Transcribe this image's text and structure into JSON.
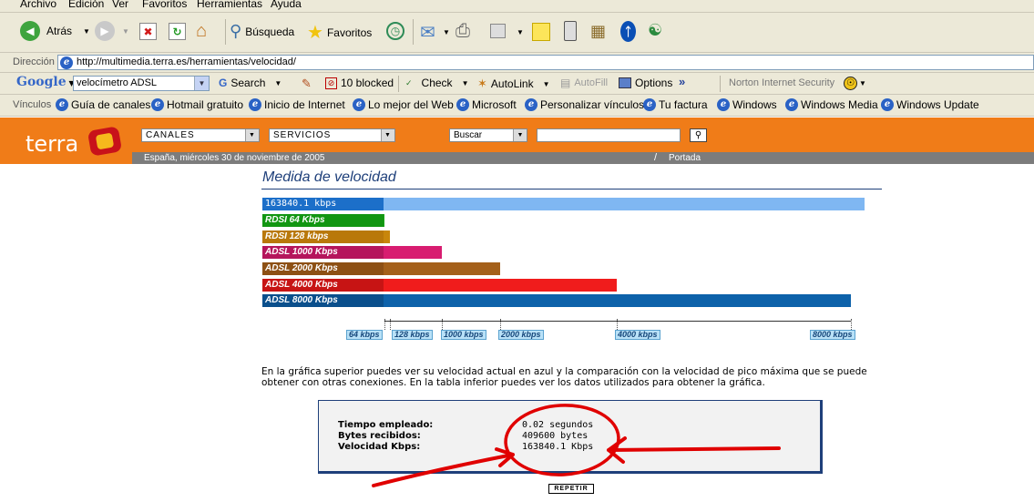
{
  "menu": [
    "Archivo",
    "Edición",
    "Ver",
    "Favoritos",
    "Herramientas",
    "Ayuda"
  ],
  "toolbar": {
    "back": "Atrás",
    "search": "Búsqueda",
    "favorites": "Favoritos"
  },
  "address": {
    "label": "Dirección",
    "url": "http://multimedia.terra.es/herramientas/velocidad/"
  },
  "google_bar": {
    "logo": "Google",
    "query": "velocímetro ADSL",
    "search": "Search",
    "blocked": "10 blocked",
    "check": "Check",
    "autolink": "AutoLink",
    "autofill": "AutoFill",
    "options": "Options",
    "more": "»",
    "norton": "Norton Internet Security"
  },
  "links": {
    "label": "Vínculos",
    "items": [
      "Guía de canales",
      "Hotmail gratuito",
      "Inicio de Internet",
      "Lo mejor del Web",
      "Microsoft",
      "Personalizar vínculos",
      "Tu factura",
      "Windows",
      "Windows Media",
      "Windows Update"
    ]
  },
  "terra": {
    "logo": "terra",
    "canales": "CANALES",
    "servicios": "SERVICIOS",
    "buscar": "Buscar",
    "search_value": "",
    "date": "España, miércoles 30 de noviembre de 2005",
    "portada": "Portada"
  },
  "page": {
    "title": "Medida de velocidad",
    "description": "En la gráfica superior puedes ver su velocidad actual en azul y la comparación con la velocidad de pico máxima que se puede obtener con otras conexiones. En la tabla inferior puedes ver los datos utilizados para obtener la gráfica.",
    "repeat_button": "REPETIR"
  },
  "chart_data": {
    "type": "bar",
    "orientation": "horizontal",
    "scale_max_kbps": 8000,
    "rows": [
      {
        "label": "163840.1 kbps",
        "value": 163840.1,
        "color": "#7fb7f2",
        "label_color": "#1c6fc9"
      },
      {
        "label": "RDSI  64 Kbps",
        "value": 64,
        "color": "#1aa51a",
        "label_color": "#129612"
      },
      {
        "label": "RDSI 128 kbps",
        "value": 128,
        "color": "#c8860c",
        "label_color": "#b9780a"
      },
      {
        "label": "ADSL 1000 Kbps",
        "value": 1000,
        "color": "#d81c70",
        "label_color": "#b5155c"
      },
      {
        "label": "ADSL 2000 Kbps",
        "value": 2000,
        "color": "#a4601a",
        "label_color": "#8d5014"
      },
      {
        "label": "ADSL 4000 Kbps",
        "value": 4000,
        "color": "#f01c1c",
        "label_color": "#c71414"
      },
      {
        "label": "ADSL 8000 Kbps",
        "value": 8000,
        "color": "#0d62aa",
        "label_color": "#0a4f8c"
      }
    ],
    "ticks": [
      {
        "label": "64 kbps",
        "value": 64
      },
      {
        "label": "128 kbps",
        "value": 128
      },
      {
        "label": "1000 kbps",
        "value": 1000
      },
      {
        "label": "2000 kbps",
        "value": 2000
      },
      {
        "label": "4000 kbps",
        "value": 4000
      },
      {
        "label": "8000 kbps",
        "value": 8000
      }
    ]
  },
  "stats": [
    {
      "key": "Tiempo empleado:",
      "value": "0.02 segundos"
    },
    {
      "key": "Bytes recibidos:",
      "value": "409600 bytes"
    },
    {
      "key": "Velocidad Kbps:",
      "value": "163840.1 Kbps"
    }
  ],
  "colors": {
    "terra_orange": "#f07c18",
    "terra_dark": "#7a7a7a",
    "annotation_red": "#e00000"
  }
}
